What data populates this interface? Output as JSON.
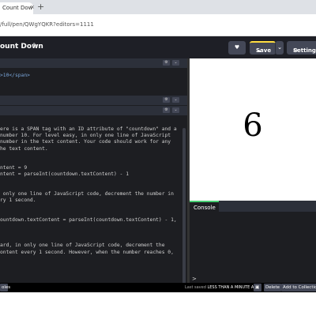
{
  "browser": {
    "tab_title": "Count Down",
    "tab_close": "×",
    "new_tab": "+",
    "url": "/full/pen/QWgYQKR?editors=1111"
  },
  "header": {
    "pen_title": "ount Down",
    "edit_icon": "✎",
    "heart": "♥",
    "save_label": "Save",
    "cloud_icon": "☁",
    "save_caret": "⌄",
    "settings_label": "Settings",
    "settings_icon": "⚙"
  },
  "html_pane": {
    "line1_tag": ">10</span>"
  },
  "js_pane": {
    "lines": [
      "ere is a SPAN tag with an ID attribute of \"countdown\" and a",
      "number 10. For level easy, in only one line of JavaScript",
      "number in the text content. Your code should work for any",
      "he text content.",
      "",
      "",
      "ntent = 9",
      "ntent = parseInt(countdown.textContent) - 1",
      "",
      "",
      " only one line of JavaScript code, decrement the number in",
      "ry 1 second.",
      "",
      "",
      "ountdown.textContent = parseInt(countdown.textContent) - 1,",
      "",
      "",
      "",
      "ard, in only one line of JavaScript code, decrement the",
      "ontent every 1 second. However, when the number reaches 0,"
    ]
  },
  "preview": {
    "countdown_value": "6"
  },
  "console": {
    "tab_label": "Console",
    "prompt": ">"
  },
  "footer": {
    "console_btn": "oles",
    "last_saved_label": "Last saved",
    "last_saved_time": "LESS THAN A MINUTE AGO",
    "delete_label": "Delete",
    "collection_label": "Add to Collection"
  }
}
